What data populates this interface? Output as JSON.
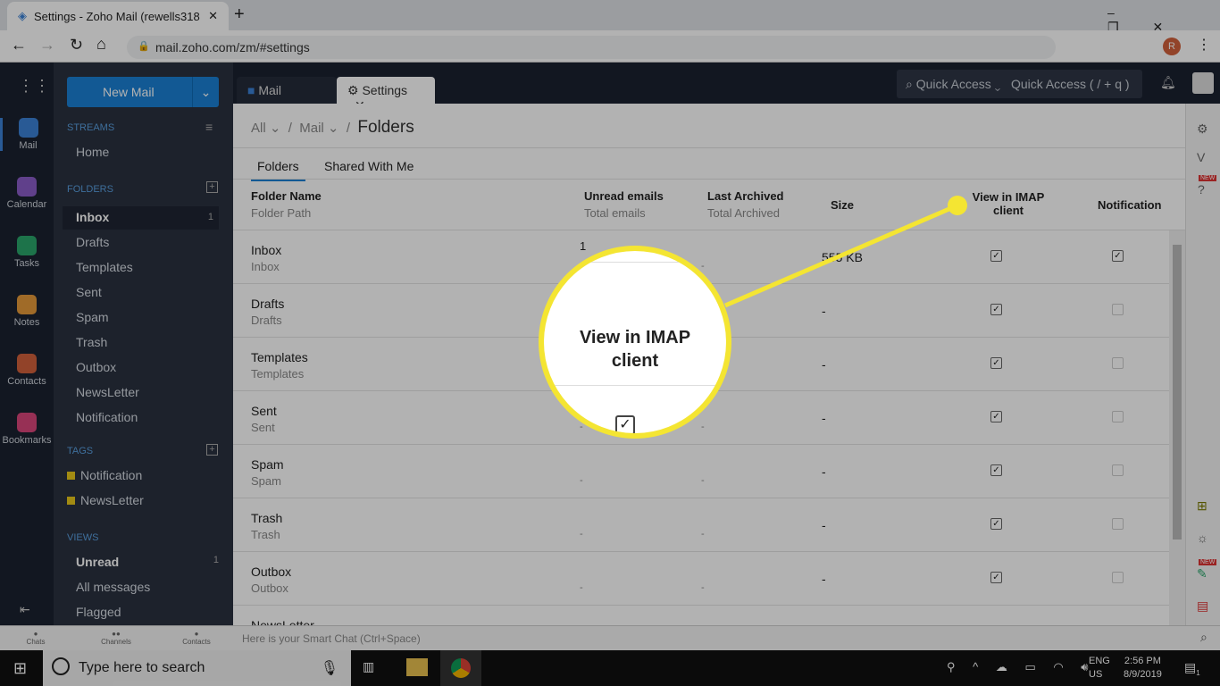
{
  "browser": {
    "tab_title": "Settings - Zoho Mail (rewells318",
    "url": "mail.zoho.com/zm/#settings",
    "profile_initial": "R"
  },
  "rail": [
    {
      "label": "Mail",
      "color": "#3b82d6"
    },
    {
      "label": "Calendar",
      "color": "#8a5cc7"
    },
    {
      "label": "Tasks",
      "color": "#2aa56b"
    },
    {
      "label": "Notes",
      "color": "#e59a3a"
    },
    {
      "label": "Contacts",
      "color": "#d2603b"
    },
    {
      "label": "Bookmarks",
      "color": "#d8457a"
    }
  ],
  "sidebar": {
    "new_mail": "New Mail",
    "streams": "STREAMS",
    "home": "Home",
    "folders_label": "FOLDERS",
    "folders": [
      {
        "name": "Inbox",
        "count": "1"
      },
      {
        "name": "Drafts"
      },
      {
        "name": "Templates"
      },
      {
        "name": "Sent"
      },
      {
        "name": "Spam"
      },
      {
        "name": "Trash"
      },
      {
        "name": "Outbox"
      },
      {
        "name": "NewsLetter"
      },
      {
        "name": "Notification"
      }
    ],
    "tags_label": "TAGS",
    "tags": [
      {
        "name": "Notification",
        "color": "#e8c81a"
      },
      {
        "name": "NewsLetter",
        "color": "#e8c81a"
      }
    ],
    "views_label": "VIEWS",
    "views": [
      {
        "name": "Unread",
        "count": "1"
      },
      {
        "name": "All messages"
      },
      {
        "name": "Flagged"
      }
    ]
  },
  "tabs": {
    "mail": "Mail",
    "settings": "Settings"
  },
  "search": {
    "quick": "Quick Access",
    "placeholder": "Quick Access  ( / + q )"
  },
  "breadcrumb": {
    "all": "All",
    "mail": "Mail",
    "current": "Folders"
  },
  "subtabs": [
    "Folders",
    "Shared With Me"
  ],
  "table": {
    "headers": {
      "name": "Folder Name",
      "path": "Folder Path",
      "unread": "Unread emails",
      "total": "Total emails",
      "archived": "Last Archived",
      "total_archived": "Total Archived",
      "size": "Size",
      "imap": "View in IMAP client",
      "notification": "Notification"
    },
    "rows": [
      {
        "name": "Inbox",
        "path": "Inbox",
        "unread": "1",
        "archived": "-",
        "size": "555 KB",
        "imap": true,
        "notify": true
      },
      {
        "name": "Drafts",
        "path": "Drafts",
        "unread": "-",
        "archived": "-",
        "size": "-",
        "imap": true,
        "notify": false
      },
      {
        "name": "Templates",
        "path": "Templates",
        "unread": "-",
        "archived": "-",
        "size": "-",
        "imap": true,
        "notify": false
      },
      {
        "name": "Sent",
        "path": "Sent",
        "unread": "-",
        "archived": "-",
        "size": "-",
        "imap": true,
        "notify": false
      },
      {
        "name": "Spam",
        "path": "Spam",
        "unread": "-",
        "archived": "-",
        "size": "-",
        "imap": true,
        "notify": false
      },
      {
        "name": "Trash",
        "path": "Trash",
        "unread": "-",
        "archived": "-",
        "size": "-",
        "imap": true,
        "notify": false
      },
      {
        "name": "Outbox",
        "path": "Outbox",
        "unread": "-",
        "archived": "-",
        "size": "-",
        "imap": true,
        "notify": false
      },
      {
        "name": "NewsLetter",
        "path": "",
        "unread": "",
        "archived": "",
        "size": "",
        "imap": true,
        "notify": false
      }
    ]
  },
  "callout": {
    "line1": "View in IMAP",
    "line2": "client",
    "color": "#f4e532"
  },
  "chatbar": {
    "chats": "Chats",
    "channels": "Channels",
    "contacts": "Contacts",
    "placeholder": "Here is your Smart Chat (Ctrl+Space)"
  },
  "taskbar": {
    "search": "Type here to search",
    "lang": "ENG",
    "region": "US",
    "time": "2:56 PM",
    "date": "8/9/2019",
    "notif_count": "1"
  },
  "badges": {
    "new": "NEW"
  }
}
